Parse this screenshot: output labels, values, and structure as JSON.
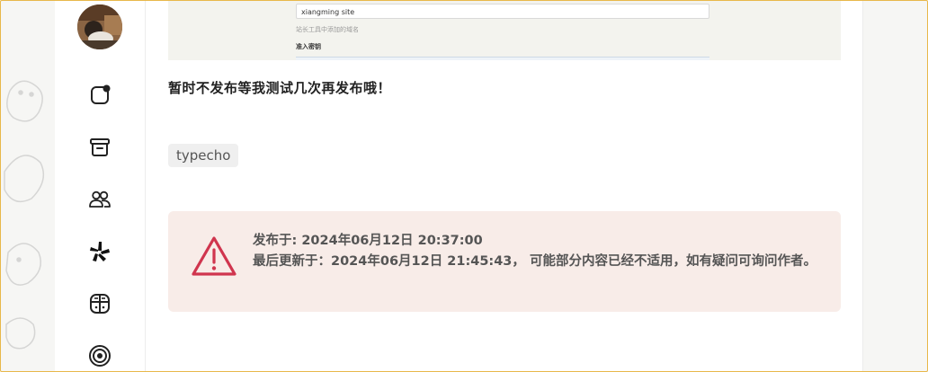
{
  "screenshot": {
    "site_input_value": "xiangming site",
    "hint": "站长工具中添加的域名",
    "label": "准入密钥"
  },
  "post": {
    "notice": "暂时不发布等我测试几次再发布哦！",
    "tag": "typecho"
  },
  "alert": {
    "published_line": "发布于: 2024年06月12日 20:37:00",
    "updated_line": "最后更新于：2024年06月12日 21:45:43， 可能部分内容已经不适用，如有疑问可询问作者。"
  },
  "sidebar": {
    "icons": [
      "bell-icon",
      "archive-icon",
      "friends-icon",
      "yelp-icon",
      "cabinet-icon",
      "target-icon"
    ]
  },
  "colors": {
    "alert_bg": "#f8ece8",
    "alert_icon": "#d0354e",
    "border_accent": "#e8b84a"
  }
}
